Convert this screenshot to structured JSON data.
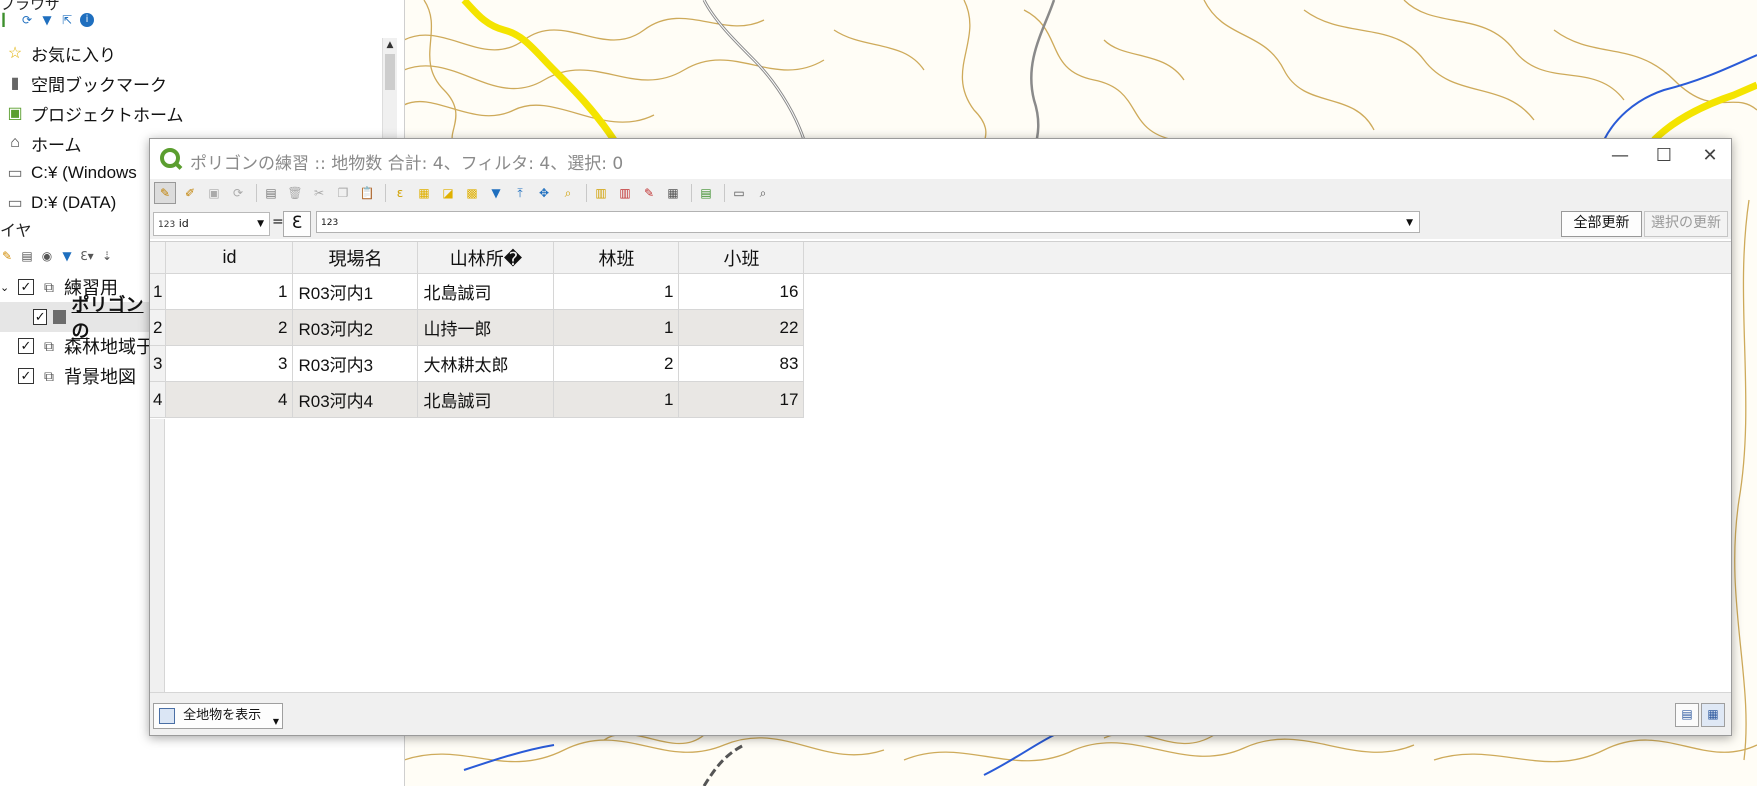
{
  "browser_panel": {
    "title": "ブラウザ",
    "items": [
      {
        "label": "お気に入り",
        "icon": "star-icon"
      },
      {
        "label": "空間ブックマーク",
        "icon": "bookmark-icon"
      },
      {
        "label": "プロジェクトホーム",
        "icon": "project-home-icon"
      },
      {
        "label": "ホーム",
        "icon": "home-icon"
      },
      {
        "label": "C:¥ (Windows",
        "icon": "folder-icon"
      },
      {
        "label": "D:¥ (DATA)",
        "icon": "folder-icon"
      }
    ]
  },
  "layers_panel": {
    "title": "イヤ",
    "layers": [
      {
        "label": "練習用",
        "checked": "✓"
      },
      {
        "label": "ポリゴンの",
        "checked": "✓"
      },
      {
        "label": "森林地域于",
        "checked": "✓"
      },
      {
        "label": "背景地図",
        "checked": "✓"
      }
    ]
  },
  "dialog": {
    "title": "ポリゴンの練習 :: 地物数 合計: 4、フィルタ: 4、選択: 0",
    "window_buttons": {
      "minimize": "—",
      "maximize": "☐",
      "close": "✕"
    },
    "field_select": {
      "type_badge": "123",
      "value": "id"
    },
    "equals": "=",
    "expression_button": "ℇ",
    "expression_value": "123",
    "update_all": "全部更新",
    "update_selected": "選択の更新",
    "show_all": "全地物を表示"
  },
  "table": {
    "columns": [
      "id",
      "現場名",
      "山林所�",
      "林班",
      "小班"
    ],
    "rows": [
      {
        "row": "1",
        "id": "1",
        "name": "R03河内1",
        "owner": "北島誠司",
        "rinpan": "1",
        "shohan": "16"
      },
      {
        "row": "2",
        "id": "2",
        "name": "R03河内2",
        "owner": "山持一郎",
        "rinpan": "1",
        "shohan": "22"
      },
      {
        "row": "3",
        "id": "3",
        "name": "R03河内3",
        "owner": "大林耕太郎",
        "rinpan": "2",
        "shohan": "83"
      },
      {
        "row": "4",
        "id": "4",
        "name": "R03河内4",
        "owner": "北島誠司",
        "rinpan": "1",
        "shohan": "17"
      }
    ]
  },
  "colors": {
    "contour": "#c9a24a",
    "road_yellow": "#f4e400",
    "river_blue": "#2a5bd7",
    "qgis_green": "#5b9e2f"
  }
}
